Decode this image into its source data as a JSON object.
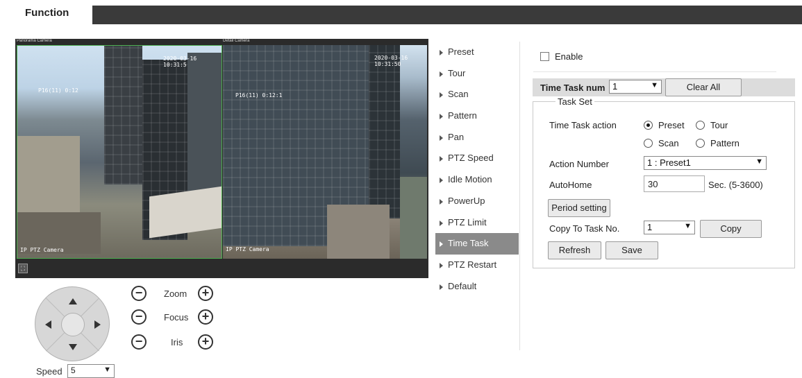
{
  "header": {
    "tab_label": "Function"
  },
  "video": {
    "panorama_label": "Panorama Camera",
    "detail_label": "Detail Camera",
    "cam1_timestamp": "2020-03-16 10:31:5",
    "cam1_overlay": "P16(11) 0:12",
    "cam1_name": "IP PTZ Camera",
    "cam2_timestamp": "2020-03-16 10:31:50",
    "cam2_overlay": "P16(11) 0:12:1",
    "cam2_name": "IP PTZ Camera"
  },
  "ptz": {
    "zoom_label": "Zoom",
    "focus_label": "Focus",
    "iris_label": "Iris",
    "speed_label": "Speed",
    "speed_value": "5"
  },
  "menu": {
    "items": [
      {
        "label": "Preset"
      },
      {
        "label": "Tour"
      },
      {
        "label": "Scan"
      },
      {
        "label": "Pattern"
      },
      {
        "label": "Pan"
      },
      {
        "label": "PTZ Speed"
      },
      {
        "label": "Idle Motion"
      },
      {
        "label": "PowerUp"
      },
      {
        "label": "PTZ Limit"
      },
      {
        "label": "Time Task"
      },
      {
        "label": "PTZ Restart"
      },
      {
        "label": "Default"
      }
    ],
    "active_index": 9
  },
  "panel": {
    "enable_label": "Enable",
    "enable_checked": false,
    "time_task_num_label": "Time Task num",
    "time_task_num_value": "1",
    "clear_all_label": "Clear All",
    "task_set_legend": "Task Set",
    "time_task_action_label": "Time Task action",
    "actions": [
      {
        "label": "Preset",
        "selected": true
      },
      {
        "label": "Tour",
        "selected": false
      },
      {
        "label": "Scan",
        "selected": false
      },
      {
        "label": "Pattern",
        "selected": false
      }
    ],
    "action_number_label": "Action Number",
    "action_number_value": "1 : Preset1",
    "autohome_label": "AutoHome",
    "autohome_value": "30",
    "autohome_hint": "Sec. (5-3600)",
    "period_setting_label": "Period setting",
    "copy_to_label": "Copy To Task No.",
    "copy_to_value": "1",
    "copy_label": "Copy",
    "refresh_label": "Refresh",
    "save_label": "Save"
  },
  "colors": {
    "active_menu_bg": "#8a8a8a",
    "header_bar": "#3a3a3a",
    "selection_border": "#4caf50"
  }
}
